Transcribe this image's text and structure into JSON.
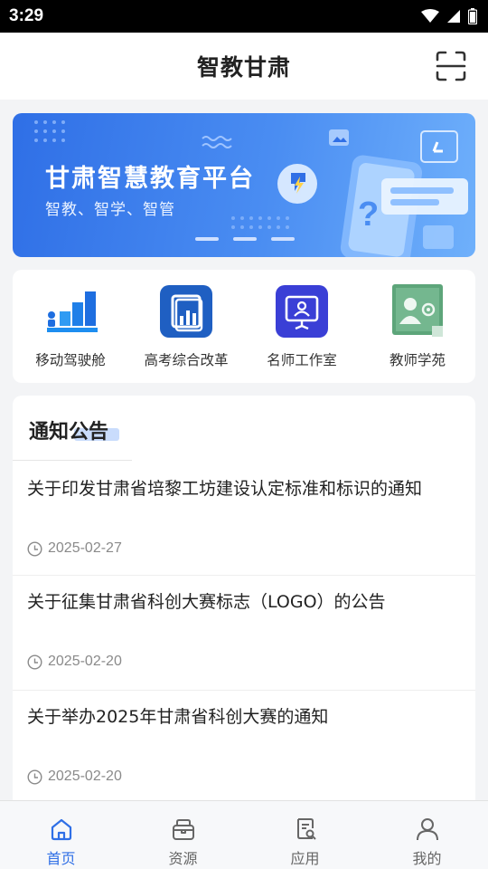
{
  "status_bar": {
    "time": "3:29"
  },
  "header": {
    "title": "智教甘肃",
    "scan_icon": "scan-icon"
  },
  "banner": {
    "title": "甘肃智慧教育平台",
    "subtitle": "智教、智学、智管",
    "colors": {
      "start": "#2f6fe6",
      "end": "#6fb0fb"
    }
  },
  "quick_links": [
    {
      "label": "移动驾驶舱",
      "icon": "bar-chart-icon"
    },
    {
      "label": "高考综合改革",
      "icon": "report-book-icon"
    },
    {
      "label": "名师工作室",
      "icon": "presenter-icon"
    },
    {
      "label": "教师学苑",
      "icon": "teacher-certificate-icon"
    }
  ],
  "notices": {
    "heading": "通知公告",
    "items": [
      {
        "title": "关于印发甘肃省培黎工坊建设认定标准和标识的通知",
        "date": "2025-02-27"
      },
      {
        "title": "关于征集甘肃省科创大赛标志（LOGO）的公告",
        "date": "2025-02-20"
      },
      {
        "title": "关于举办2025年甘肃省科创大赛的通知",
        "date": "2025-02-20"
      }
    ]
  },
  "tabs": [
    {
      "label": "首页",
      "icon": "home-icon",
      "active": true
    },
    {
      "label": "资源",
      "icon": "box-icon",
      "active": false
    },
    {
      "label": "应用",
      "icon": "search-document-icon",
      "active": false
    },
    {
      "label": "我的",
      "icon": "user-icon",
      "active": false
    }
  ],
  "colors": {
    "accent": "#2f6fe6",
    "tab_inactive": "#666666"
  }
}
